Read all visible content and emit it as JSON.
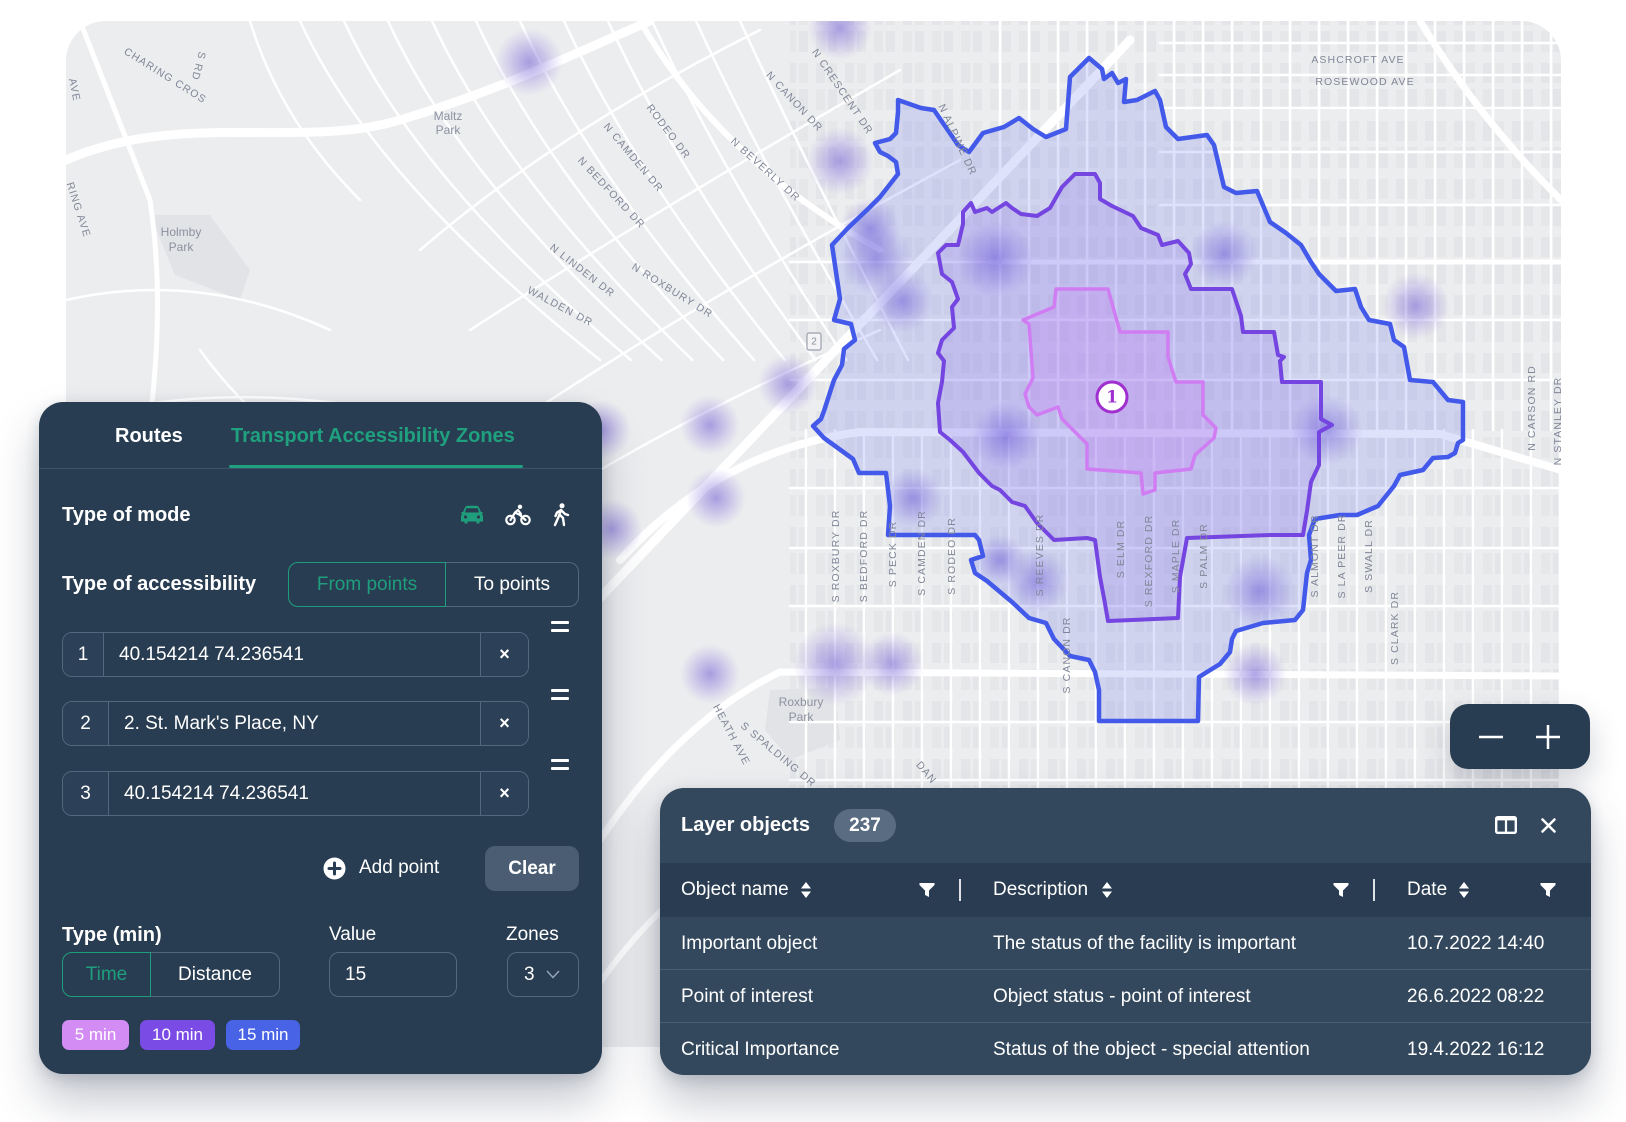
{
  "app": {
    "accent_color": "#1E9E7C",
    "panel_color": "#293D52"
  },
  "panel": {
    "tabs": [
      {
        "label": "Routes",
        "active": false
      },
      {
        "label": "Transport Accessibility Zones",
        "active": true
      }
    ],
    "mode": {
      "label": "Type of mode",
      "options": [
        {
          "icon": "car-icon",
          "active": true
        },
        {
          "icon": "bicycle-icon",
          "active": false
        },
        {
          "icon": "walking-icon",
          "active": false
        }
      ]
    },
    "accessibility": {
      "label": "Type of accessibility",
      "options": [
        "From points",
        "To points"
      ],
      "selected": "From points"
    },
    "points": [
      {
        "index": "1",
        "value": "40.154214 74.236541"
      },
      {
        "index": "2",
        "value": "2. St. Mark's Place, NY"
      },
      {
        "index": "3",
        "value": "40.154214 74.236541"
      }
    ],
    "clear_point_glyph": "×",
    "add_point_label": "Add point",
    "clear_label": "Clear",
    "type": {
      "label": "Type (min)",
      "options": [
        "Time",
        "Distance"
      ],
      "selected": "Time"
    },
    "value": {
      "label": "Value",
      "value": "15"
    },
    "zones": {
      "label": "Zones",
      "value": "3"
    },
    "legend": [
      {
        "label": "5 min",
        "color": "#D38CF4"
      },
      {
        "label": "10 min",
        "color": "#7B4BE6"
      },
      {
        "label": "15 min",
        "color": "#4863E6"
      }
    ]
  },
  "table": {
    "title": "Layer objects",
    "count": "237",
    "columns": [
      "Object name",
      "Description",
      "Date"
    ],
    "rows": [
      [
        "Important object",
        "The status of the facility is important",
        "10.7.2022 14:40"
      ],
      [
        "Point of interest",
        "Object status - point of interest",
        "26.6.2022 08:22"
      ],
      [
        "Critical Importance",
        "Status of the object - special attention",
        "19.4.2022 16:12"
      ]
    ]
  },
  "map": {
    "marker": "1",
    "shield": "2",
    "isochrones": [
      {
        "minutes": 5,
        "stroke": "#D07CF2"
      },
      {
        "minutes": 10,
        "stroke": "#7445E0"
      },
      {
        "minutes": 15,
        "stroke": "#4259EA"
      }
    ],
    "labels": [
      "CHARING CROS",
      "S RD",
      "Maltz",
      "Park",
      "Holmby",
      "Park",
      "AVE",
      "RING AVE",
      "RODEO DR",
      "N CAMDEN DR",
      "N BEDFORD DR",
      "N CANON DR",
      "N CRESCENT DR",
      "N BEVERLY DR",
      "N LINDEN DR",
      "N ROXBURY DR",
      "WALDEN DR",
      "N ALPINE DR",
      "ASHCROFT AVE",
      "ROSEWOOD AVE",
      "N CARSON RD",
      "N STANLEY DR",
      "S ROXBURY DR",
      "S BEDFORD DR",
      "S PECK DR",
      "S CAMDEN DR",
      "S RODEO DR",
      "S REEVES DR",
      "S CANON DR",
      "S ELM DR",
      "S REXFORD DR",
      "S MAPLE DR",
      "S PALM DR",
      "S ALMONT DR",
      "S LA PEER DR",
      "S SWALL DR",
      "S CLARK DR",
      "Roxbury",
      "Park",
      "HEATH AVE",
      "S SPALDING DR",
      "DAN"
    ]
  }
}
